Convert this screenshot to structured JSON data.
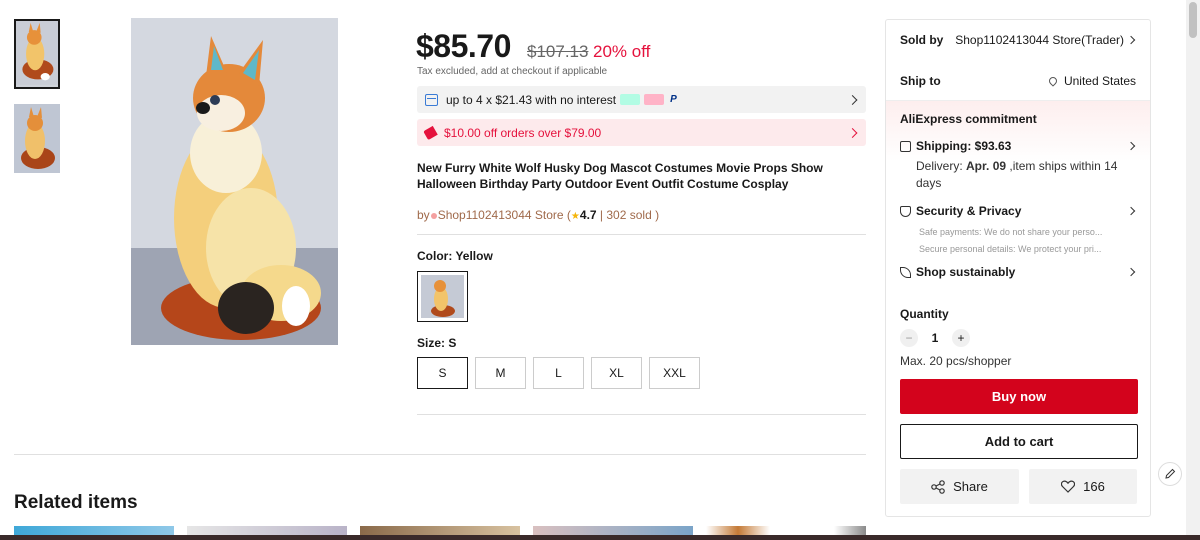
{
  "gallery": {
    "thumbnails": [
      "fox-mascot-thumbnail-1",
      "fox-mascot-thumbnail-2"
    ],
    "main_image": "fox-mascot-photo"
  },
  "price": {
    "current": "$85.70",
    "original": "$107.13",
    "discount": "20% off",
    "tax_note": "Tax excluded, add at checkout if applicable"
  },
  "installment": {
    "text": "up to 4 x $21.43 with no interest",
    "logos": [
      "afterpay",
      "klarna",
      "paypal"
    ]
  },
  "coupon": {
    "text": "$10.00 off orders over $79.00"
  },
  "product": {
    "title": "New Furry White Wolf Husky Dog Mascot Costumes Movie Props Show Halloween Birthday Party Outdoor Event Outfit Costume Cosplay"
  },
  "seller_line": {
    "by": "by",
    "store": "Shop1102413044 Store",
    "open_paren": " (",
    "star": "★",
    "rating": "4.7",
    "sep": " | ",
    "sold": "302 sold",
    "close_paren": " )"
  },
  "color": {
    "label": "Color: Yellow"
  },
  "size": {
    "label": "Size: S",
    "options": [
      "S",
      "M",
      "L",
      "XL",
      "XXL"
    ],
    "selected": "S"
  },
  "related": {
    "title": "Related items"
  },
  "panel": {
    "sold_by_label": "Sold by",
    "sold_by_value": "Shop1102413044 Store(Trader)",
    "ship_to_label": "Ship to",
    "ship_to_value": "United States",
    "commitment_title": "AliExpress commitment",
    "shipping_title": "Shipping: $93.63",
    "delivery_prefix": "Delivery: ",
    "delivery_date": "Apr. 09",
    "delivery_suffix": " ,item ships within 14 days",
    "security_title": "Security & Privacy",
    "security_line1": "Safe payments: We do not share your perso...",
    "security_line2": "Secure personal details: We protect your pri...",
    "sustain_title": "Shop sustainably",
    "quantity_label": "Quantity",
    "quantity_minus": "−",
    "quantity_value": "1",
    "quantity_plus": "+",
    "max_text": "Max. 20 pcs/shopper",
    "buy_now": "Buy now",
    "add_to_cart": "Add to cart",
    "share": "Share",
    "likes": "166"
  },
  "colors": {
    "accent_red": "#d3031c",
    "discount_red": "#e5123d",
    "seller_brown": "#a06a4b"
  }
}
